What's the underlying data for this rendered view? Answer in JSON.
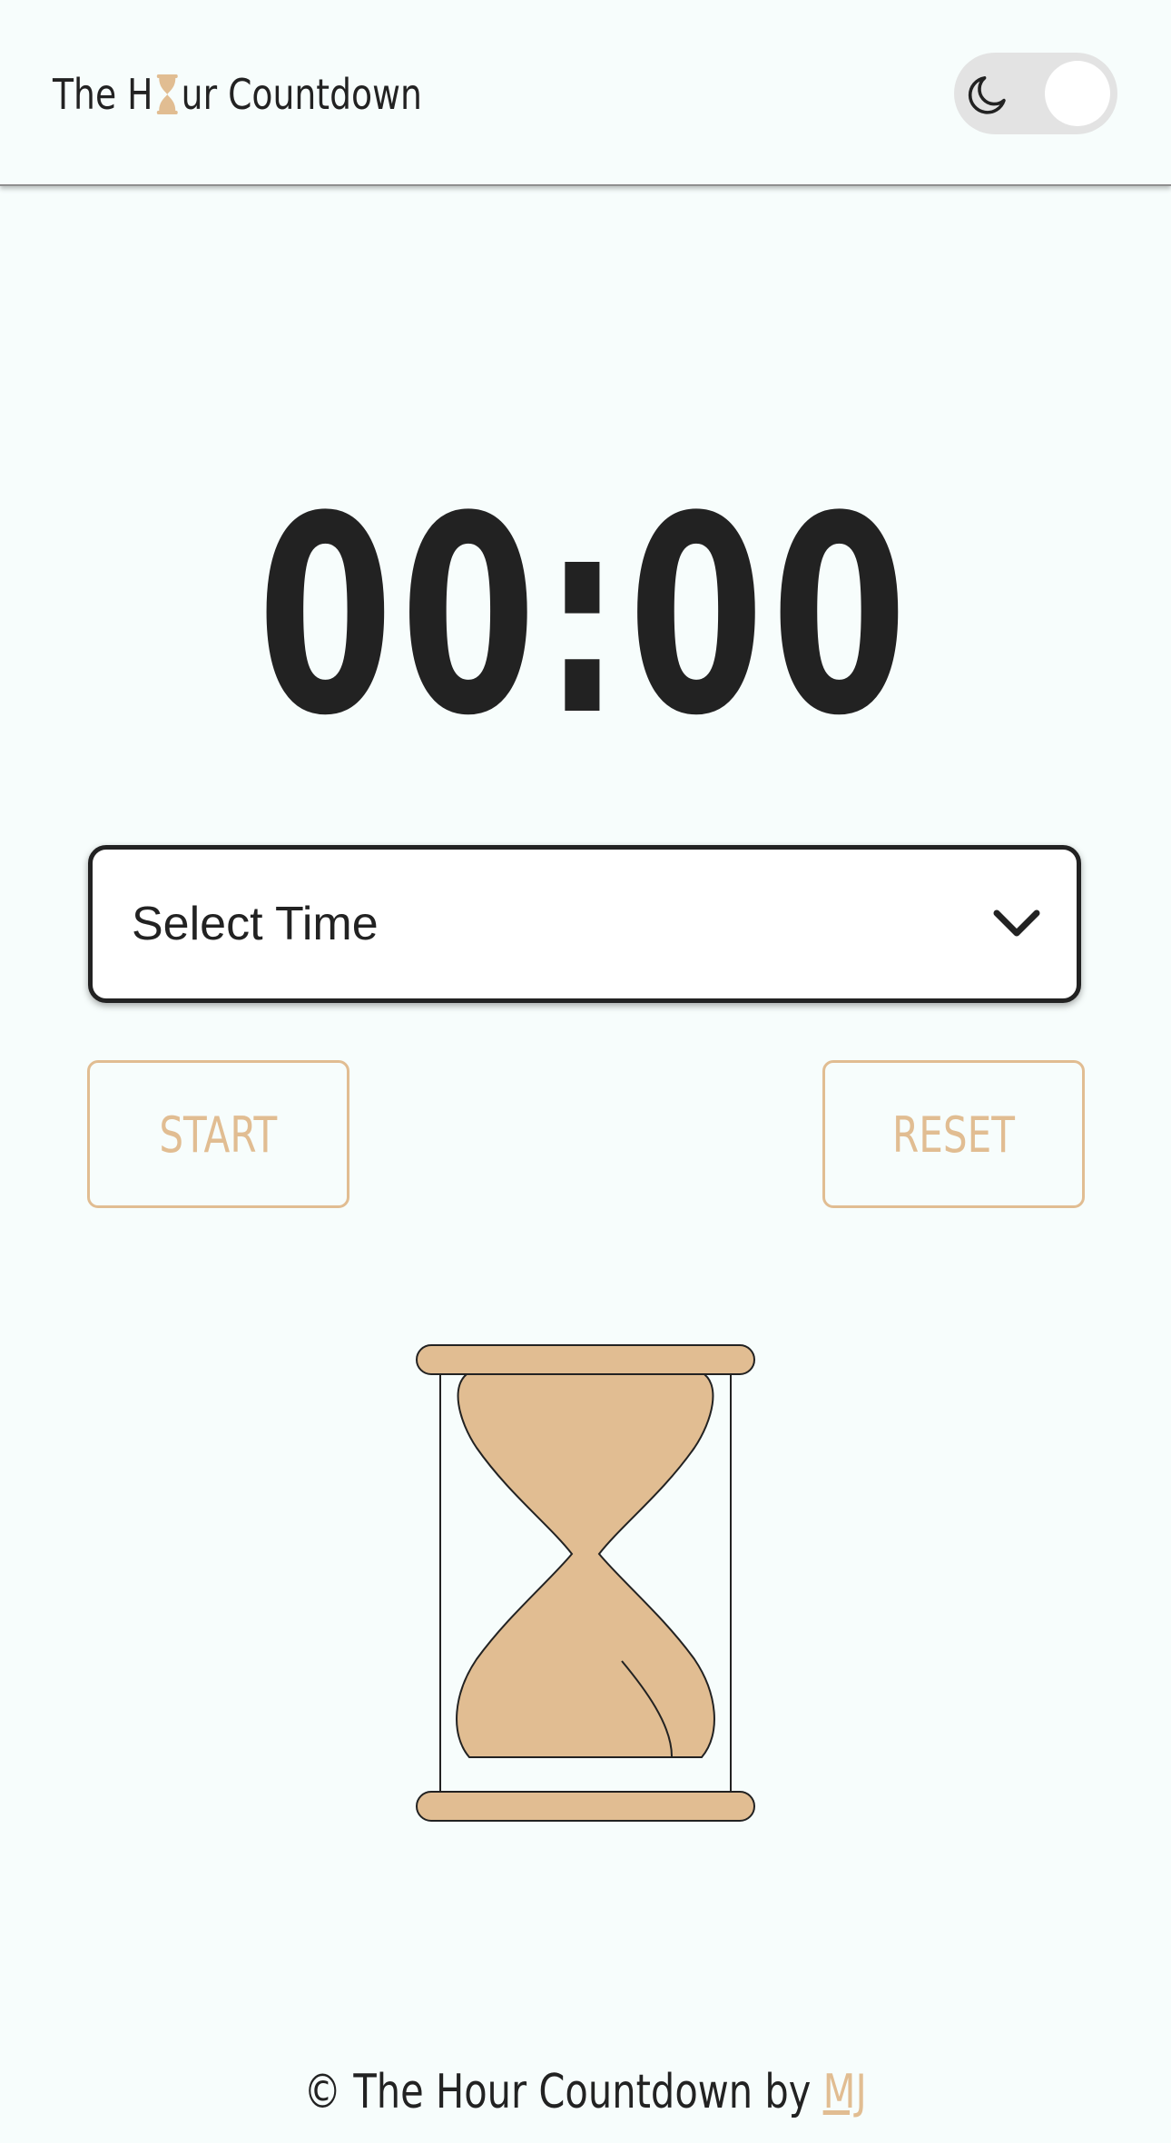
{
  "header": {
    "title_before": "The H",
    "title_icon": "hourglass-icon",
    "title_after": "ur Countdown",
    "theme_toggle_icon": "moon-icon"
  },
  "timer": {
    "display": "00:00"
  },
  "time_select": {
    "selected_label": "Select Time",
    "icon": "chevron-down-icon"
  },
  "buttons": {
    "start_label": "START",
    "reset_label": "RESET"
  },
  "illustration": {
    "icon": "hourglass-icon"
  },
  "footer": {
    "prefix": "© The Hour Countdown by ",
    "author_link": "MJ"
  },
  "colors": {
    "accent": "#e1bd92",
    "text": "#222222",
    "background": "#f7fdfc"
  }
}
